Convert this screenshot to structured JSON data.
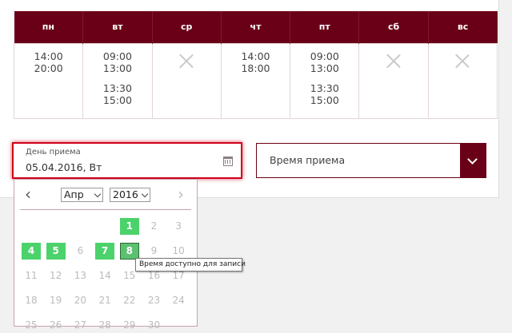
{
  "schedule": {
    "days": [
      "пн",
      "вт",
      "ср",
      "чт",
      "пт",
      "сб",
      "вс"
    ],
    "mon": [
      "14:00",
      "20:00"
    ],
    "tue": [
      "09:00",
      "13:00",
      "13:30",
      "15:00"
    ],
    "thu": [
      "14:00",
      "18:00"
    ],
    "fri": [
      "09:00",
      "13:00",
      "13:30",
      "15:00"
    ],
    "unavailable_icon": "cross-icon"
  },
  "date_field": {
    "label": "День приема",
    "value": "05.04.2016, Вт",
    "icon": "calendar-icon"
  },
  "time_field": {
    "placeholder": "Время приема",
    "icon": "chevron-down-icon"
  },
  "datepicker": {
    "prev": "‹",
    "next": "›",
    "month": "Апр",
    "year": "2016",
    "available_color": "#4cd26b",
    "days": [
      {
        "n": "1",
        "avail": true
      },
      {
        "n": "2"
      },
      {
        "n": "3"
      },
      {
        "n": "4",
        "avail": true
      },
      {
        "n": "5",
        "avail": true
      },
      {
        "n": "6"
      },
      {
        "n": "7",
        "avail": true
      },
      {
        "n": "8",
        "avail": true,
        "hover": true
      },
      {
        "n": "9"
      },
      {
        "n": "10"
      },
      {
        "n": "11"
      },
      {
        "n": "12"
      },
      {
        "n": "13"
      },
      {
        "n": "14"
      },
      {
        "n": "15"
      },
      {
        "n": "16"
      },
      {
        "n": "17"
      },
      {
        "n": "18"
      },
      {
        "n": "19"
      },
      {
        "n": "20"
      },
      {
        "n": "21"
      },
      {
        "n": "22"
      },
      {
        "n": "23"
      },
      {
        "n": "24"
      },
      {
        "n": "25"
      },
      {
        "n": "26"
      },
      {
        "n": "27"
      },
      {
        "n": "28"
      },
      {
        "n": "29"
      },
      {
        "n": "30"
      }
    ]
  },
  "tooltip": "Время доступно для записи",
  "colors": {
    "brand": "#6a0017",
    "focus": "#d0021b"
  }
}
